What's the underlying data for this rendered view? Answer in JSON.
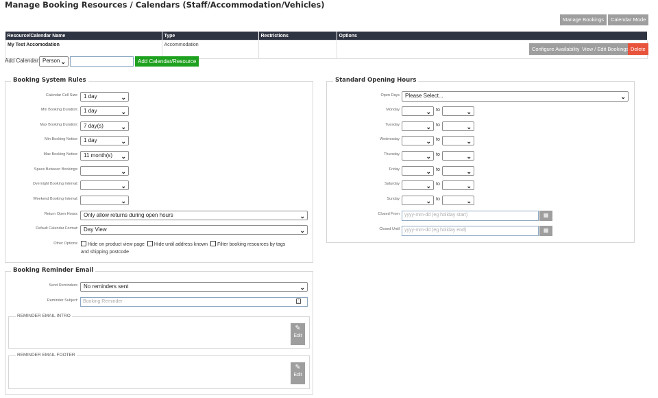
{
  "page": {
    "title": "Manage Booking Resources / Calendars (Staff/Accommodation/Vehicles)"
  },
  "top_buttons": {
    "manage_bookings": "Manage Bookings",
    "calendar_mode": "Calendar Mode"
  },
  "table": {
    "headers": [
      "Resource/Calendar Name",
      "Type",
      "Restrictions",
      "Options"
    ],
    "rows": [
      {
        "name": "My Test Accomodation",
        "type": "Accommodation",
        "restrictions": "",
        "actions": {
          "configure": "Configure Availability",
          "view_edit": "View / Edit Bookings",
          "delete": "Delete"
        }
      }
    ]
  },
  "add_calendar": {
    "label": "Add Calendar:",
    "type_value": "Person",
    "name_value": "",
    "button": "Add Calendar/Resource"
  },
  "rules": {
    "title": "Booking System Rules",
    "fields": [
      {
        "label": "Calendar Cell Size:",
        "value": "1 day"
      },
      {
        "label": "Min Booking Duration:",
        "value": "1 day"
      },
      {
        "label": "Max Booking Duration:",
        "value": "7 day(s)"
      },
      {
        "label": "Min Booking Notice:",
        "value": "1 day"
      },
      {
        "label": "Max Booking Notice:",
        "value": "11 month(s)"
      },
      {
        "label": "Space Between Bookings:",
        "value": ""
      },
      {
        "label": "Overnight Booking Interval:",
        "value": ""
      },
      {
        "label": "Weekend Booking Interval:",
        "value": ""
      }
    ],
    "return_open_hours": {
      "label": "Return Open Hours:",
      "value": "Only allow returns during open hours"
    },
    "default_format": {
      "label": "Default Calendar Format:",
      "value": "Day View"
    },
    "other_options": {
      "label": "Other Options:",
      "opt1": "Hide on product view page",
      "opt2": "Hide until address known",
      "opt3": "Filter booking resources by tags",
      "opt3_cont": "and shipping postcode"
    }
  },
  "reminder": {
    "title": "Booking Reminder Email",
    "send": {
      "label": "Send Reminders:",
      "value": "No reminders sent"
    },
    "subject": {
      "label": "Reminder Subject:",
      "placeholder": "Booking Reminder"
    },
    "intro": {
      "title": "REMINDER EMAIL INTRO",
      "edit": "Edit"
    },
    "footer": {
      "title": "REMINDER EMAIL FOOTER",
      "edit": "Edit"
    }
  },
  "hours": {
    "title": "Standard Opening Hours",
    "open_days": {
      "label": "Open Days",
      "value": "Please Select..."
    },
    "days": [
      "Monday",
      "Tuesday",
      "Wednesday",
      "Thursday",
      "Friday",
      "Saturday",
      "Sunday"
    ],
    "to": "to",
    "closed_from": {
      "label": "Closed From",
      "placeholder": "yyyy-mm-dd (eg holiday start)"
    },
    "closed_until": {
      "label": "Closed Until",
      "placeholder": "yyyy-mm-dd (eg holiday end)"
    }
  },
  "icons": {
    "dropdown": "chevron-down-icon",
    "calendar": "calendar-icon",
    "edit": "pencil-icon",
    "text_field": "text-field-icon"
  },
  "colors": {
    "header_bg": "#2f3442",
    "gray_button": "#9e9e9e",
    "delete": "#e8533b",
    "add": "#1ea11e"
  }
}
